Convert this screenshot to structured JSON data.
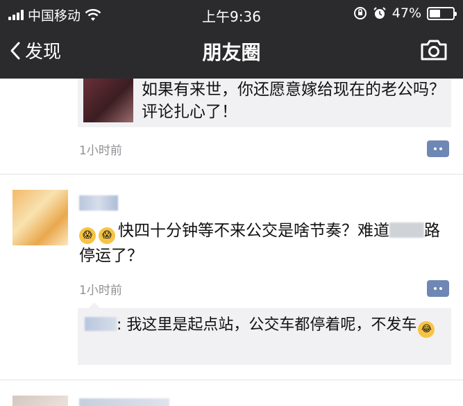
{
  "status_bar": {
    "carrier": "中国移动",
    "time": "上午9:36",
    "battery": "47%",
    "battery_level": 0.47
  },
  "nav": {
    "back_label": "发现",
    "title": "朋友圈"
  },
  "posts": [
    {
      "share_text": "如果有来世，你还愿意嫁给现在的老公吗？评论扎心了！",
      "time": "1小时前"
    },
    {
      "text_before": "快四十分钟等不来公交是啥节奏？难道",
      "text_after": "路停运了？",
      "time": "1小时前",
      "comments": [
        {
          "text": "我这里是起点站，公交车都停着呢，不发车"
        }
      ]
    }
  ],
  "colors": {
    "header_bg": "#2b2b2d",
    "comment_button": "#6f87b5",
    "card_bg": "#f1f1f3",
    "timestamp": "#8f8f94"
  },
  "icons": [
    "signal-icon",
    "wifi-icon",
    "orientation-lock-icon",
    "alarm-icon",
    "battery-icon",
    "back-chevron-icon",
    "camera-icon",
    "comment-icon",
    "scared-emoji-icon",
    "tears-of-joy-emoji-icon"
  ]
}
